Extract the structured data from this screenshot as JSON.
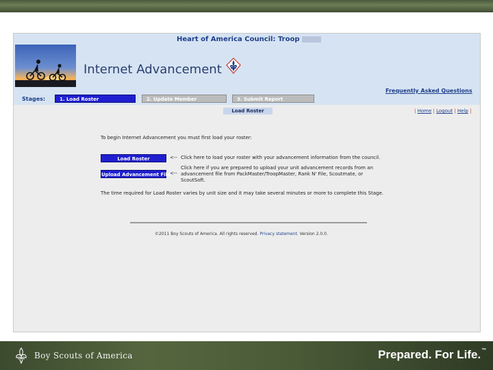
{
  "slide": {
    "brand_text": "Boy Scouts of America",
    "tagline": "Prepared. For Life.",
    "trademark": "™"
  },
  "app": {
    "council_title": "Heart of America Council: Troop",
    "title": "Internet Advancement",
    "faq_link": "Frequently Asked Questions",
    "stages_label": "Stages:",
    "stages": [
      {
        "label": "1. Load Roster",
        "active": true
      },
      {
        "label": "2. Update Member",
        "active": false
      },
      {
        "label": "3. Submit Report",
        "active": false
      }
    ],
    "page_heading": "Load Roster",
    "links": {
      "home": "Home",
      "logout": "Logout",
      "help": "Help",
      "separator": "|"
    }
  },
  "content": {
    "intro": "To begin Internet Advancement you must first load your roster:",
    "load_button": "Load Roster",
    "upload_button": "Upload Advancement File",
    "arrow": "<--",
    "load_desc": "Click here to load your roster with your advancement information from the council.",
    "upload_desc": "Click here if you are prepared to upload your unit advancement records from an advancement file from PackMaster/TroopMaster, Rank N' File, Scoutmate, or ScoutSoft.",
    "note": "The time required for Load Roster varies by unit size and it may take several minutes or more to complete this Stage."
  },
  "footer": {
    "copyright": "©2011 Boy Scouts of America. All rights reserved.",
    "privacy": "Privacy statement",
    "version": ". Version 2.0.0."
  },
  "colors": {
    "button": "#1f1fd0",
    "header_bg": "#d6e3f3",
    "title": "#2a3f6e"
  },
  "icons": [
    "bsa-fleur-de-lis-icon",
    "bicyclists-photo"
  ]
}
